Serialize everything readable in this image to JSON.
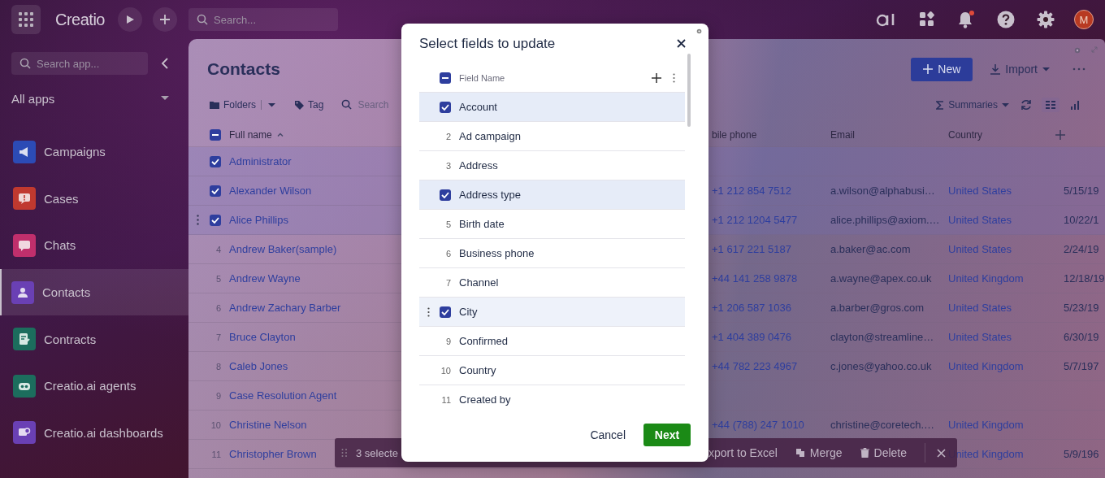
{
  "topbar": {
    "logo": "Creatio",
    "search": {
      "placeholder": "Search..."
    },
    "notifications_unread": true,
    "avatar": "M"
  },
  "sidebar": {
    "search": {
      "placeholder": "Search app..."
    },
    "section": "All apps",
    "items": [
      {
        "label": "Campaigns",
        "color": "#2c4bb5",
        "selected": false
      },
      {
        "label": "Cases",
        "color": "#c0392f",
        "selected": false
      },
      {
        "label": "Chats",
        "color": "#c02f6c",
        "selected": false
      },
      {
        "label": "Contacts",
        "color": "#6a40b4",
        "selected": true
      },
      {
        "label": "Contracts",
        "color": "#1c6d5d",
        "selected": false
      },
      {
        "label": "Creatio.ai agents",
        "color": "#1c6d5d",
        "selected": false
      },
      {
        "label": "Creatio.ai dashboards",
        "color": "#6a40b4",
        "selected": false
      }
    ]
  },
  "page": {
    "title": "Contacts",
    "new_button": "New",
    "import_button": "Import",
    "toolbar": {
      "folders": "Folders",
      "tag": "Tag",
      "search": {
        "placeholder": "Search"
      },
      "summaries": "Summaries"
    }
  },
  "table": {
    "select_all_indeterminate": true,
    "sort_ascending": true,
    "columns": [
      "Full name",
      "bile phone",
      "Email",
      "Country"
    ],
    "rows": [
      {
        "checked": true,
        "hovered": false,
        "name": "Administrator"
      },
      {
        "checked": true,
        "hovered": false,
        "name": "Alexander Wilson",
        "phone": "+1 212 854 7512",
        "email": "a.wilson@alphabusi…",
        "country": "United States",
        "date": "5/15/19"
      },
      {
        "checked": true,
        "hovered": true,
        "name": "Alice Phillips",
        "phone": "+1 212 1204 5477",
        "email": "alice.phillips@axiom.…",
        "country": "United States",
        "date": "10/22/1"
      },
      {
        "checked": false,
        "hovered": false,
        "index": "4",
        "name": "Andrew Baker(sample)",
        "phone": "+1 617 221 5187",
        "email": "a.baker@ac.com",
        "country": "United States",
        "date": "2/24/19"
      },
      {
        "checked": false,
        "hovered": false,
        "index": "5",
        "name": "Andrew Wayne",
        "phone": "+44 141 258 9878",
        "email": "a.wayne@apex.co.uk",
        "country": "United Kingdom",
        "date": "12/18/19"
      },
      {
        "checked": false,
        "hovered": false,
        "index": "6",
        "name": "Andrew Zachary Barber",
        "phone": "+1 206 587 1036",
        "email": "a.barber@gros.com",
        "country": "United States",
        "date": "5/23/19"
      },
      {
        "checked": false,
        "hovered": false,
        "index": "7",
        "name": "Bruce Clayton",
        "phone": "+1 404 389 0476",
        "email": "clayton@streamline…",
        "country": "United States",
        "date": "6/30/19"
      },
      {
        "checked": false,
        "hovered": false,
        "index": "8",
        "name": "Caleb Jones",
        "phone": "+44 782 223 4967",
        "email": "c.jones@yahoo.co.uk",
        "country": "United Kingdom",
        "date": "5/7/197"
      },
      {
        "checked": false,
        "hovered": false,
        "index": "9",
        "name": "Case Resolution Agent"
      },
      {
        "checked": false,
        "hovered": false,
        "index": "10",
        "name": "Christine Nelson",
        "phone": "+44 (788) 247 1010",
        "email": "christine@coretech.…",
        "country": "United Kingdom"
      },
      {
        "checked": false,
        "hovered": false,
        "index": "11",
        "name": "Christopher Brown",
        "country": "United Kingdom",
        "date": "5/9/196"
      }
    ]
  },
  "selection_bar": {
    "count": "3 selecte",
    "actions": [
      "xport to Excel",
      "Merge",
      "Delete"
    ]
  },
  "modal": {
    "title": "Select fields to update",
    "header": "Field Name",
    "select_all_indeterminate": true,
    "fields": [
      {
        "label": "Account",
        "checked": true,
        "hovered": false
      },
      {
        "index": "2",
        "label": "Ad campaign",
        "checked": false,
        "hovered": false
      },
      {
        "index": "3",
        "label": "Address",
        "checked": false,
        "hovered": false
      },
      {
        "label": "Address type",
        "checked": true,
        "hovered": false
      },
      {
        "index": "5",
        "label": "Birth date",
        "checked": false,
        "hovered": false
      },
      {
        "index": "6",
        "label": "Business phone",
        "checked": false,
        "hovered": false
      },
      {
        "index": "7",
        "label": "Channel",
        "checked": false,
        "hovered": false
      },
      {
        "label": "City",
        "checked": true,
        "hovered": true
      },
      {
        "index": "9",
        "label": "Confirmed",
        "checked": false,
        "hovered": false
      },
      {
        "index": "10",
        "label": "Country",
        "checked": false,
        "hovered": false
      },
      {
        "index": "11",
        "label": "Created by",
        "checked": false,
        "hovered": false
      }
    ],
    "cancel": "Cancel",
    "next": "Next"
  }
}
